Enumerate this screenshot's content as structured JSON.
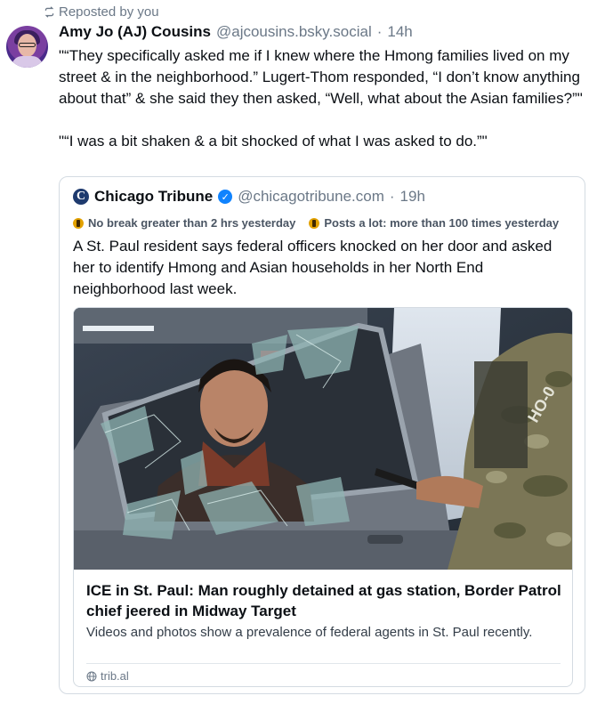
{
  "repost": {
    "label": "Reposted by you",
    "icon": "repost-icon"
  },
  "post": {
    "author_name": "Amy Jo (AJ) Cousins",
    "author_handle": "@ajcousins.bsky.social",
    "separator": "·",
    "time": "14h",
    "text_1": "\"“They specifically asked me if I knew where the Hmong families lived on my street & in the neighborhood.” Lugert-Thom responded, “I don’t know anything about that” & she said they then asked, “Well, what about the Asian families?”\"",
    "text_2": "\"“I was a bit shaken & a bit shocked of what I was asked to do.”\""
  },
  "quote": {
    "logo_letter": "C",
    "name": "Chicago Tribune",
    "handle": "@chicagotribune.com",
    "separator": "·",
    "time": "19h",
    "labels": [
      {
        "text": "No break greater than 2 hrs yesterday",
        "icon": "moderation-label-icon"
      },
      {
        "text": "Posts a lot: more than 100 times yesterday",
        "icon": "moderation-label-icon"
      }
    ],
    "text": "A St. Paul resident says federal officers knocked on her door and asked her to identify Hmong and Asian households in her North End neighborhood last week.",
    "link": {
      "title": "ICE in St. Paul: Man roughly detained at gas station, Border Patrol chief jeered in Midway Target",
      "description": "Videos and photos show a prevalence of federal agents in St. Paul recently.",
      "domain": "trib.al",
      "image_text": "HO-0"
    }
  },
  "colors": {
    "accent": "#1083fe",
    "muted": "#6b7887",
    "label_icon": "#e2a100"
  }
}
